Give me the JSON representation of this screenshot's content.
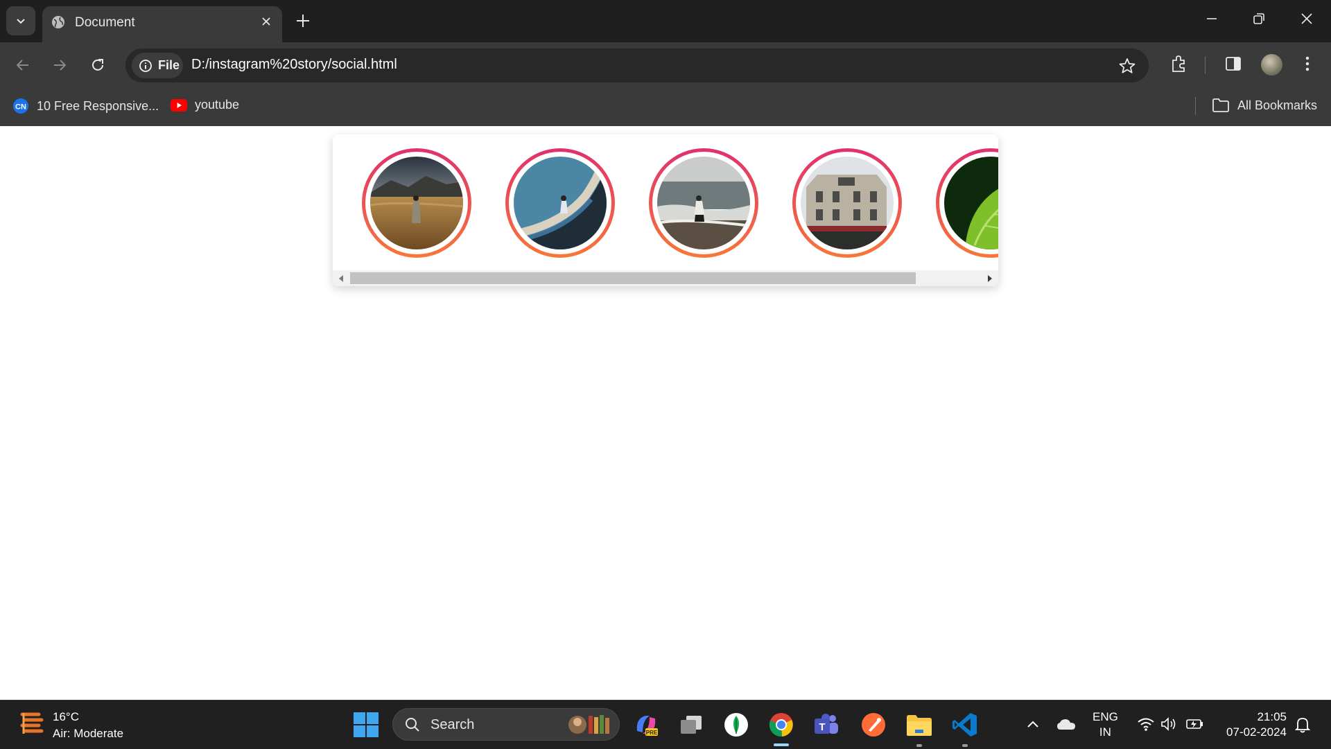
{
  "browser": {
    "tab_title": "Document",
    "omnibox_chip": "File",
    "url": "D:/instagram%20story/social.html",
    "bookmarks": [
      {
        "label": "10 Free Responsive...",
        "icon": "codepen-style-icon"
      },
      {
        "label": "youtube",
        "icon": "youtube-icon"
      }
    ],
    "all_bookmarks": "All Bookmarks"
  },
  "stories": [
    {
      "name": "story-1",
      "scene": "person in golden wheat field under mountains"
    },
    {
      "name": "story-2",
      "scene": "person on curved slide against blue sky"
    },
    {
      "name": "story-3",
      "scene": "person walking on beach by the sea"
    },
    {
      "name": "story-4",
      "scene": "historic building with cafe awning"
    },
    {
      "name": "story-5",
      "scene": "green leaf close-up"
    }
  ],
  "taskbar": {
    "weather_temp": "16°C",
    "weather_desc": "Air: Moderate",
    "search_label": "Search",
    "lang_top": "ENG",
    "lang_bottom": "IN",
    "time": "21:05",
    "date": "07-02-2024"
  },
  "colors": {
    "story_ring_top": "#e1306c",
    "story_ring_bottom": "#f77737",
    "chrome_bg": "#1f1f1f",
    "toolbar_bg": "#3a3a3a"
  }
}
